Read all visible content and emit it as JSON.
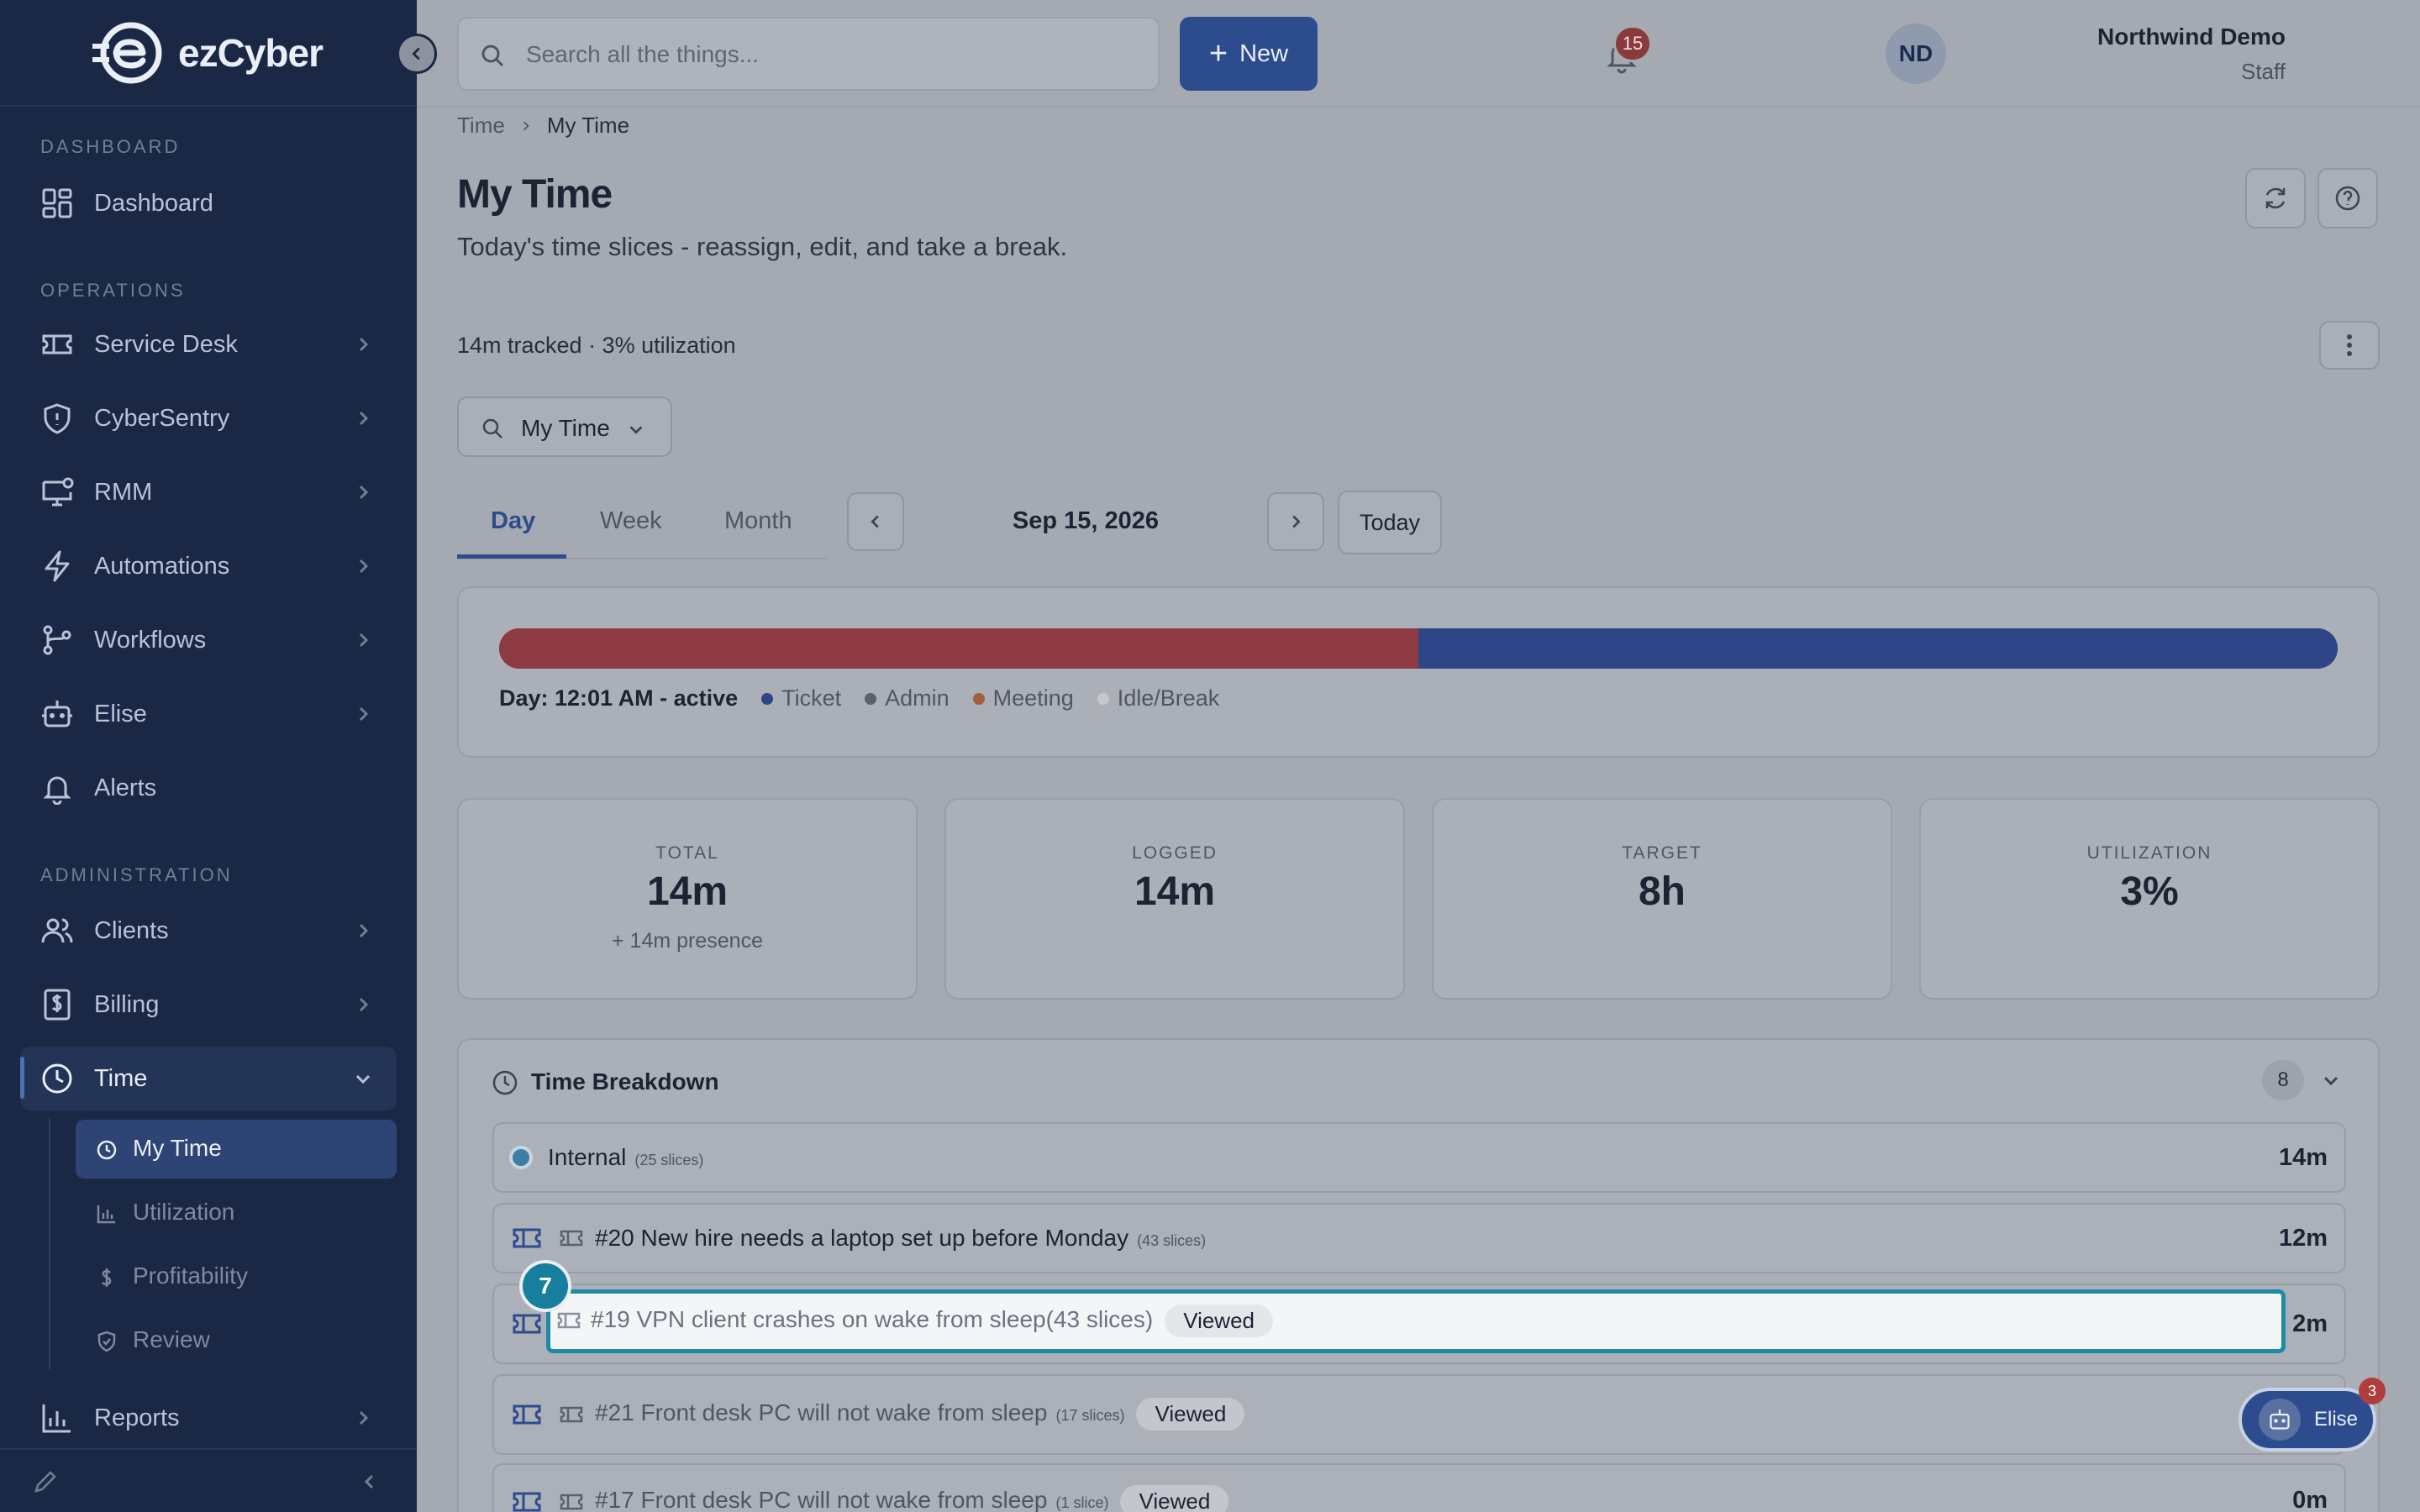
{
  "app": {
    "brand": "ezCyber"
  },
  "sidebar": {
    "sections": {
      "dashboard": "DASHBOARD",
      "operations": "OPERATIONS",
      "administration": "ADMINISTRATION"
    },
    "items": {
      "dashboard": "Dashboard",
      "service_desk": "Service Desk",
      "cybersentry": "CyberSentry",
      "rmm": "RMM",
      "automations": "Automations",
      "workflows": "Workflows",
      "elise": "Elise",
      "alerts": "Alerts",
      "clients": "Clients",
      "billing": "Billing",
      "time": "Time",
      "reports": "Reports"
    },
    "time_sub": {
      "my_time": "My Time",
      "utilization": "Utilization",
      "profitability": "Profitability",
      "review": "Review"
    }
  },
  "topbar": {
    "search_placeholder": "Search all the things...",
    "new_label": "New",
    "notifications_count": "15",
    "user_name": "Northwind Demo",
    "user_role": "Staff",
    "user_initials": "ND"
  },
  "breadcrumb": {
    "parent": "Time",
    "current": "My Time"
  },
  "page": {
    "title": "My Time",
    "subtitle": "Today's time slices - reassign, edit, and take a break.",
    "tracked_summary": "14m tracked · 3% utilization",
    "filter_label": "My Time"
  },
  "tabs": {
    "day": "Day",
    "week": "Week",
    "month": "Month"
  },
  "date_nav": {
    "date": "Sep 15, 2026",
    "today_label": "Today"
  },
  "timeline": {
    "ticket_fraction": 0.5,
    "day_label": "Day: 12:01 AM - active",
    "legend": {
      "ticket": "Ticket",
      "admin": "Admin",
      "meeting": "Meeting",
      "idle": "Idle/Break"
    },
    "colors": {
      "ticket": "#2e4688",
      "admin": "#5b6070",
      "meeting": "#a0603a",
      "idle": "#c4c7cd"
    }
  },
  "stats": {
    "total": {
      "label": "TOTAL",
      "value": "14m",
      "sub": "+ 14m presence"
    },
    "logged": {
      "label": "LOGGED",
      "value": "14m"
    },
    "target": {
      "label": "TARGET",
      "value": "8h"
    },
    "utilization": {
      "label": "UTILIZATION",
      "value": "3%"
    }
  },
  "breakdown": {
    "title": "Time Breakdown",
    "count": "8",
    "rows": [
      {
        "label": "Internal",
        "slices": "(25 slices)",
        "duration": "14m"
      },
      {
        "label": "#20 New hire needs a laptop set up before Monday",
        "slices": "(43 slices)",
        "duration": "12m"
      },
      {
        "label": "#19 VPN client crashes on wake from sleep",
        "slices": "(43 slices)",
        "badge": "Viewed",
        "duration": "2m"
      },
      {
        "label": "#21 Front desk PC will not wake from sleep",
        "slices": "(17 slices)",
        "badge": "Viewed",
        "duration": ""
      },
      {
        "label": "#17 Front desk PC will not wake from sleep",
        "slices": "(1 slice)",
        "badge": "Viewed",
        "duration": "0m"
      }
    ]
  },
  "overlay": {
    "step_number": "7",
    "assistant_label": "Elise",
    "assistant_badge": "3"
  }
}
